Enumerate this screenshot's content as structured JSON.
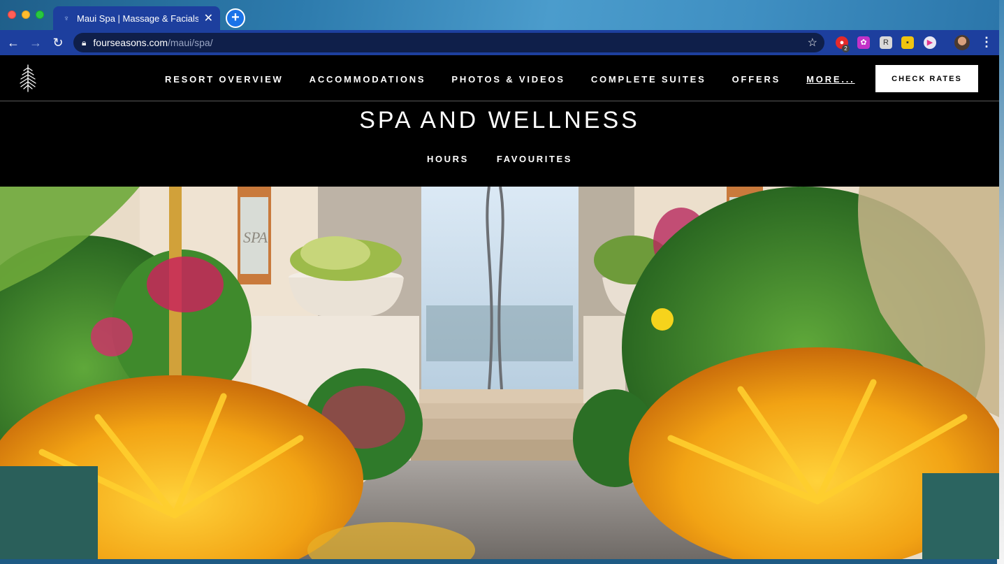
{
  "browser": {
    "tab_title": "Maui Spa | Massage & Facials |",
    "url_host": "fourseasons.com",
    "url_path": "/maui/spa/",
    "extension_badge": "2",
    "accent": "#1d3f9e"
  },
  "header": {
    "nav": [
      "RESORT OVERVIEW",
      "ACCOMMODATIONS",
      "PHOTOS & VIDEOS",
      "COMPLETE SUITES",
      "OFFERS",
      "MORE..."
    ],
    "check_rates_label": "CHECK RATES"
  },
  "section": {
    "title": "SPA AND WELLNESS",
    "subnav": [
      "HOURS",
      "FAVOURITES"
    ]
  },
  "hero": {
    "image_description_icon": "spa-entrance-garden-image",
    "sign_text": "SPA"
  }
}
